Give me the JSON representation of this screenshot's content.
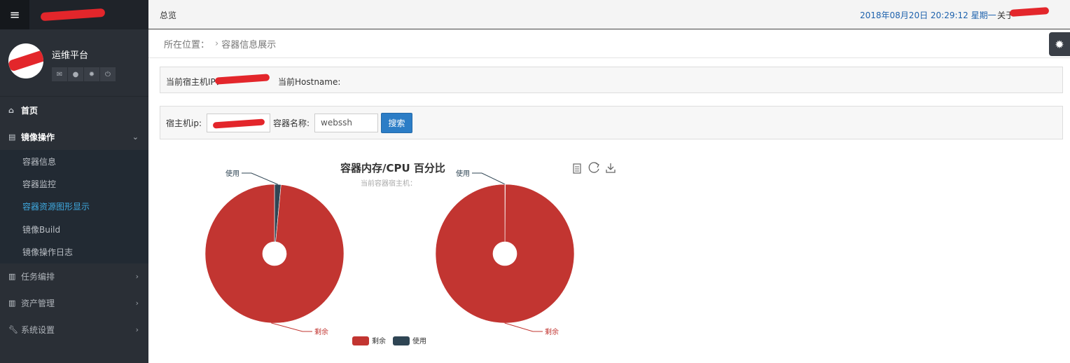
{
  "header": {
    "menu_icon": "hamburger-icon",
    "title": "总览",
    "datetime": "2018年08月20日 20:29:12 星期一",
    "about_label": "关于"
  },
  "sidebar": {
    "platform_name": "运维平台",
    "profile_icons": [
      "envelope-icon",
      "user-icon",
      "gear-icon",
      "power-icon"
    ],
    "home_label": "首页",
    "image_ops_label": "镜像操作",
    "submenu": [
      {
        "label": "容器信息",
        "active": false
      },
      {
        "label": "容器监控",
        "active": false
      },
      {
        "label": "容器资源图形显示",
        "active": true
      },
      {
        "label": "镜像Build",
        "active": false
      },
      {
        "label": "镜像操作日志",
        "active": false
      }
    ],
    "task_label": "任务编排",
    "asset_label": "资产管理",
    "system_label": "系统设置"
  },
  "breadcrumb": {
    "prefix": "所在位置：",
    "current": "容器信息展示"
  },
  "host_panel": {
    "host_ip_label": "当前宿主机IP：",
    "hostname_label": "当前Hostname:"
  },
  "search": {
    "host_ip_label": "宿主机ip:",
    "container_name_label": "容器名称:",
    "container_name_value": "webssh",
    "search_button": "搜索"
  },
  "chart_data": {
    "type": "pie",
    "title": "容器内存/CPU 百分比",
    "subtitle": "当前容器宿主机：",
    "toolbox": [
      "data-view-icon",
      "refresh-icon",
      "download-icon"
    ],
    "legend": [
      "剩余",
      "使用"
    ],
    "colors": {
      "剩余": "#c23531",
      "使用": "#2f4554"
    },
    "pies": [
      {
        "slices": [
          {
            "name": "使用",
            "value": 1.5
          },
          {
            "name": "剩余",
            "value": 98.5
          }
        ]
      },
      {
        "slices": [
          {
            "name": "使用",
            "value": 0.1
          },
          {
            "name": "剩余",
            "value": 99.9
          }
        ]
      }
    ]
  }
}
